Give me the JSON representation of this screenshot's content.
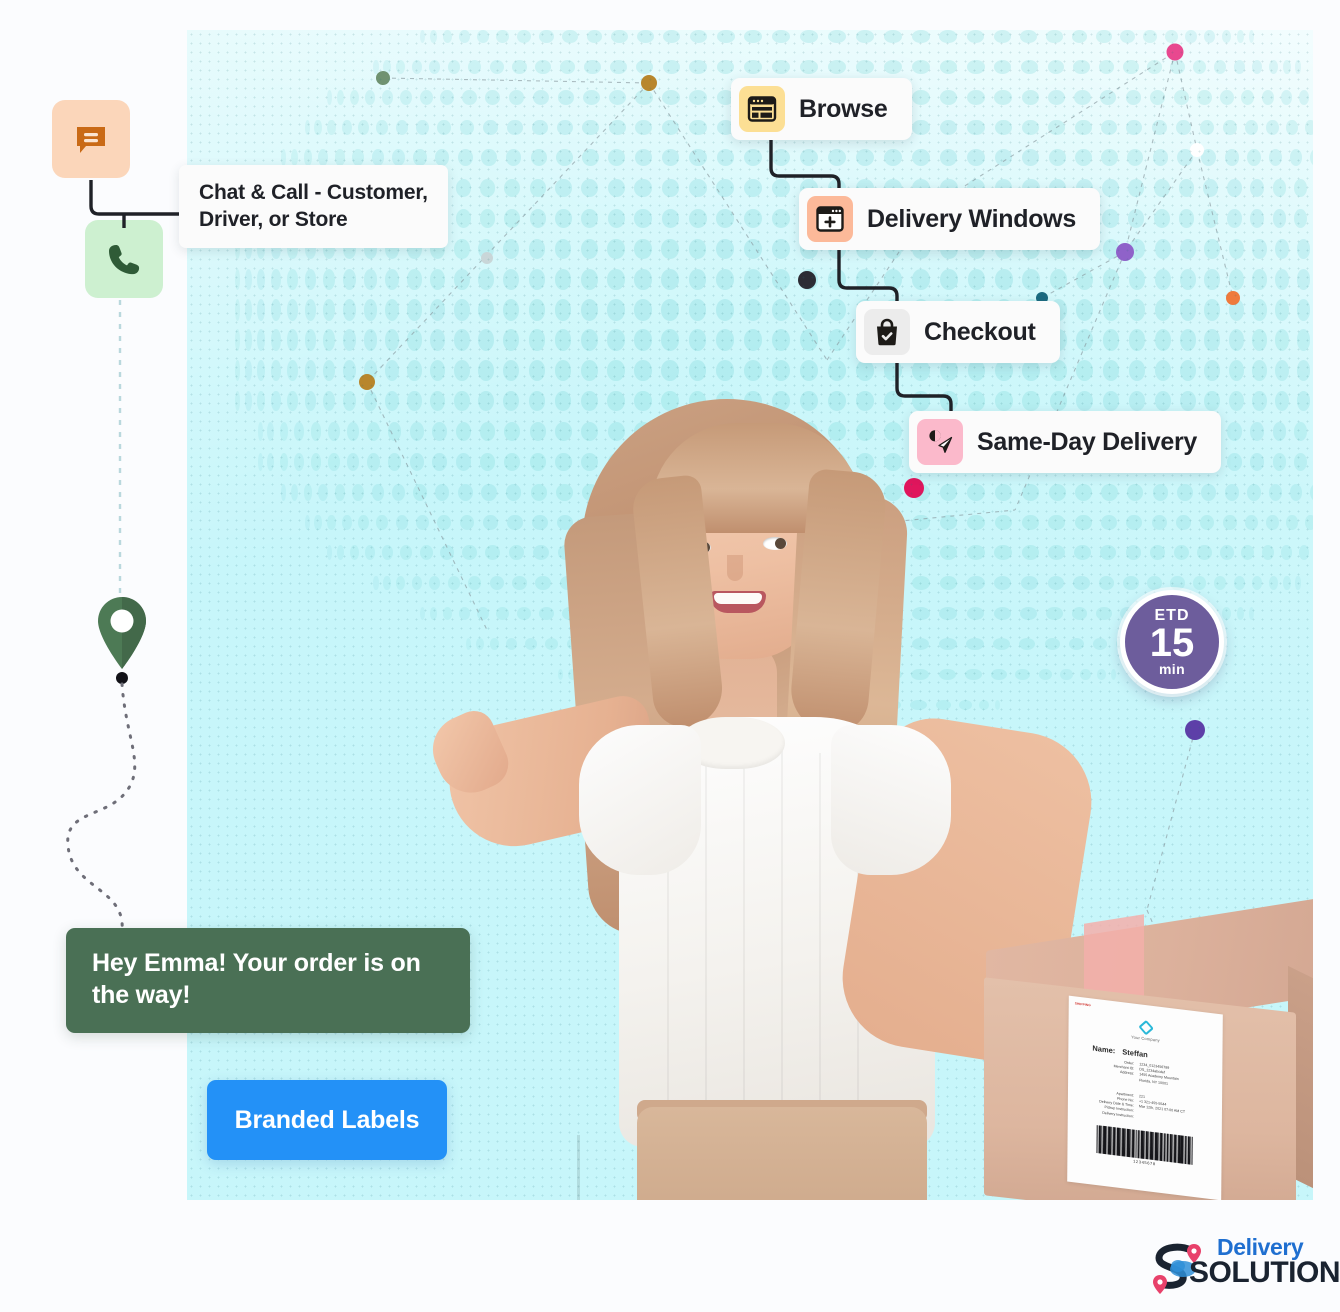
{
  "canvas": {
    "background_color": "#c7f6fa",
    "page_background": "#fbfcfe"
  },
  "flow_cards": [
    {
      "label": "Browse",
      "icon": "browser-window-icon",
      "icon_bg": "#fcdf94"
    },
    {
      "label": "Delivery Windows",
      "icon": "calendar-plus-icon",
      "icon_bg": "#fcb999"
    },
    {
      "label": "Checkout",
      "icon": "shopping-bag-check-icon",
      "icon_bg": "#ececec"
    },
    {
      "label": "Same-Day Delivery",
      "icon": "paper-plane-location-icon",
      "icon_bg": "#fbb9cb"
    }
  ],
  "contact": {
    "label": "Chat & Call - Customer, Driver, or Store",
    "line1": "Chat & Call - Customer,",
    "line2": "Driver, or Store",
    "chat_icon": "chat-bubble-icon",
    "chat_icon_bg": "#fbd6ba",
    "call_icon": "phone-icon",
    "call_icon_bg": "#cdf0d0"
  },
  "etd_badge": {
    "title": "ETD",
    "value": "15",
    "unit": "min",
    "color": "#6d5d9c"
  },
  "banners": {
    "notification": {
      "line1": "Hey Emma! Your order is on",
      "line2": "the way!",
      "color": "#4a7055"
    },
    "branded_labels": {
      "label": "Branded Labels",
      "color": "#2391f7"
    }
  },
  "shipping_label": {
    "carrier_mark": "SHIPPING",
    "company_name": "Your Company",
    "name_key": "Name:",
    "name_value": "Steffan",
    "rows": [
      {
        "key": "Order:",
        "value": "1234_0123456789"
      },
      {
        "key": "Merchant ID:",
        "value": "DS_1234abcdef"
      },
      {
        "key": "Address:",
        "value": "1455 Academy Mountain"
      },
      {
        "key": "",
        "value": "Florida, NY 10001"
      }
    ],
    "rows2": [
      {
        "key": "Apartment:",
        "value": "221"
      },
      {
        "key": "Phone No:",
        "value": "+1 321-455-5544"
      },
      {
        "key": "Delivery Date & Time:",
        "value": "Mar 12th, 2021 07:00 AM CT"
      },
      {
        "key": "Pickup Instruction:",
        "value": ""
      },
      {
        "key": "Delivery Instruction:",
        "value": ""
      }
    ],
    "barcode_number": "12345678"
  },
  "brand": {
    "word1": "Delivery",
    "word2": "SOLUTIONS",
    "word1_color": "#1f6fd0",
    "word2_color": "#1a2330",
    "pin_color": "#e8416b",
    "route_color": "#1a2330",
    "cloud_color": "#2f8fd8"
  },
  "map_pin": {
    "color": "#4d7a55",
    "name": "location-pin"
  },
  "network_nodes": [
    {
      "color": "#6f9271"
    },
    {
      "color": "#b8862c"
    },
    {
      "color": "#e8488f"
    },
    {
      "color": "#8f62c9"
    },
    {
      "color": "#ffffff"
    },
    {
      "color": "#1b6a80"
    },
    {
      "color": "#ef7a3c"
    },
    {
      "color": "#2c2c34"
    },
    {
      "color": "#e0165d"
    },
    {
      "color": "#5d3fa8"
    }
  ]
}
